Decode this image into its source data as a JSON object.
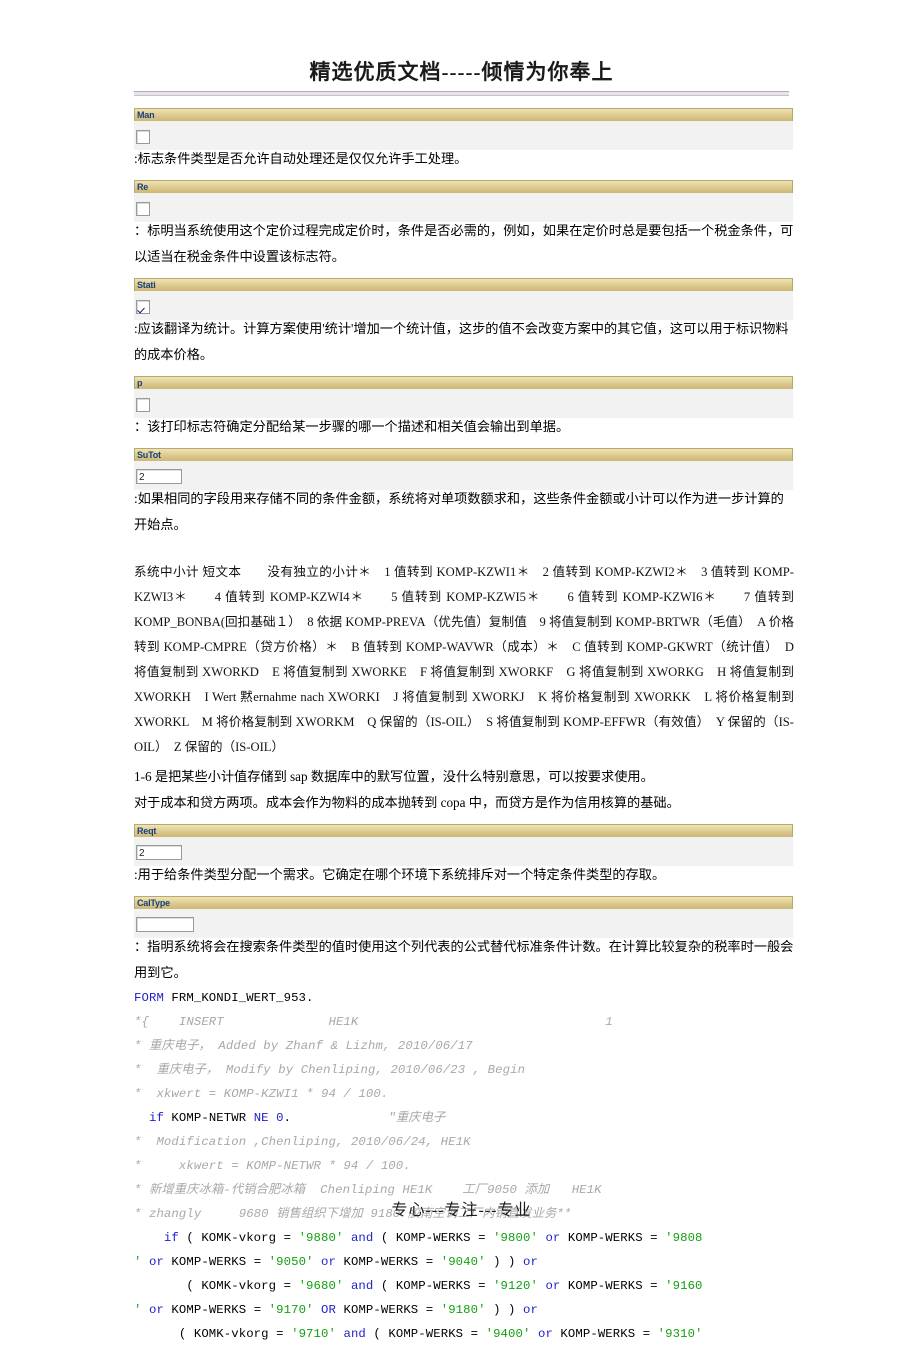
{
  "header": {
    "title": "精选优质文档-----倾情为你奉上"
  },
  "footer": {
    "text": "专心---专注---专业"
  },
  "fields": {
    "man": {
      "caption": "Man",
      "control": "checkbox",
      "checked": false
    },
    "re": {
      "caption": "Re",
      "control": "checkbox",
      "checked": false
    },
    "stat": {
      "caption": "Stati",
      "control": "checkbox",
      "checked": true
    },
    "print": {
      "caption": "p",
      "control": "checkbox",
      "checked": false
    },
    "sutot": {
      "caption": "SuTot",
      "control": "input",
      "value": "2"
    },
    "reqt": {
      "caption": "Reqt",
      "control": "input",
      "value": "2"
    },
    "caltype": {
      "caption": "CalType",
      "control": "input",
      "value": ""
    }
  },
  "paragraphs": {
    "man": ":标志条件类型是否允许自动处理还是仅仅允许手工处理。",
    "re": "：标明当系统使用这个定价过程完成定价时，条件是否必需的，例如，如果在定价时总是要包括一个税金条件，可以适当在税金条件中设置该标志符。",
    "stat": ":应该翻译为统计。计算方案使用'统计'增加一个统计值，这步的值不会改变方案中的其它值，这可以用于标识物料的成本价格。",
    "print": "：该打印标志符确定分配给某一步骤的哪一个描述和相关值会输出到单据。",
    "sutot": ":如果相同的字段用来存储不同的条件金额，系统将对单项数额求和，这些条件金额或小计可以作为进一步计算的开始点。",
    "subtotal_list": "系统中小计 短文本　　没有独立的小计＊　1 值转到 KOMP-KZWI1＊　2 值转到 KOMP-KZWI2＊　3 值转到 KOMP-KZWI3＊　　4 值转到 KOMP-KZWI4＊　　5 值转到 KOMP-KZWI5＊　　6 值转到 KOMP-KZWI6＊　　7 值转到 KOMP_BONBA(回扣基础１）　8 依据 KOMP-PREVA（优先值）复制值　9 将值复制到 KOMP-BRTWR（毛值）　A 价格转到 KOMP-CMPRE（贷方价格）＊　B 值转到 KOMP-WAVWR（成本）＊　C 值转到 KOMP-GKWRT（统计值）　D 将值复制到 XWORKD　E 将值复制到 XWORKE　F 将值复制到 XWORKF　G 将值复制到 XWORKG　H 将值复制到 XWORKH　I Wert 黙ernahme nach XWORKI　J 将值复制到 XWORKJ　K 将价格复制到 XWORKK　L 将价格复制到 XWORKL　M 将价格复制到 XWORKM　Q 保留的（IS-OIL）　S 将值复制到 KOMP-EFFWR（有效值）　Y 保留的（IS-OIL）　Z 保留的（IS-OIL）",
    "note1": "1-6 是把某些小计值存储到 sap 数据库中的默写位置，没什么特别意思，可以按要求使用。",
    "note2": "对于成本和贷方两项。成本会作为物料的成本抛转到 copa 中，而贷方是作为信用核算的基础。",
    "reqt": ":用于给条件类型分配一个需求。它确定在哪个环境下系统排斥对一个特定条件类型的存取。",
    "caltype": "：指明系统将会在搜索条件类型的值时使用这个列代表的公式替代标准条件计数。在计算比较复杂的税率时一般会用到它。"
  },
  "code": {
    "lines": [
      [
        {
          "t": "FORM",
          "c": "kw"
        },
        {
          "t": " FRM_KONDI_WERT_953.",
          "c": "plain"
        }
      ],
      [
        {
          "t": "*{    INSERT              HE1K                                 1",
          "c": "cmt"
        }
      ],
      [
        {
          "t": "* 重庆电子， Added by Zhanf & Lizhm, 2010/06/17",
          "c": "cmt"
        }
      ],
      [
        {
          "t": "*  重庆电子， Modify by Chenliping, 2010/06/23 , Begin",
          "c": "cmt"
        }
      ],
      [
        {
          "t": "*  xkwert = KOMP-KZWI1 * 94 / 100.",
          "c": "cmt"
        }
      ],
      [
        {
          "t": "  ",
          "c": "plain"
        },
        {
          "t": "if",
          "c": "kw"
        },
        {
          "t": " KOMP-NETWR ",
          "c": "plain"
        },
        {
          "t": "NE",
          "c": "kw"
        },
        {
          "t": " ",
          "c": "plain"
        },
        {
          "t": "0",
          "c": "num"
        },
        {
          "t": ".             ",
          "c": "plain"
        },
        {
          "t": "\"重庆电子",
          "c": "cmt"
        }
      ],
      [
        {
          "t": "*  Modification ,Chenliping, 2010/06/24, HE1K",
          "c": "cmt"
        }
      ],
      [
        {
          "t": "*     xkwert = KOMP-NETWR * 94 / 100.",
          "c": "cmt"
        }
      ],
      [
        {
          "t": "* 新增重庆冰箱-代销合肥冰箱  Chenliping HE1K    工厂9050 添加   HE1K",
          "c": "cmt"
        }
      ],
      [
        {
          "t": "* zhangly     9680 销售组织下增加 9180 胶南空调工厂内销直发业务**",
          "c": "cmt"
        }
      ],
      [
        {
          "t": "    ",
          "c": "plain"
        },
        {
          "t": "if",
          "c": "kw"
        },
        {
          "t": " ( KOMK-vkorg = ",
          "c": "plain"
        },
        {
          "t": "'9880'",
          "c": "str"
        },
        {
          "t": " ",
          "c": "plain"
        },
        {
          "t": "and",
          "c": "kw"
        },
        {
          "t": " ( KOMP-WERKS = ",
          "c": "plain"
        },
        {
          "t": "'9800'",
          "c": "str"
        },
        {
          "t": " ",
          "c": "plain"
        },
        {
          "t": "or",
          "c": "kw"
        },
        {
          "t": " KOMP-WERKS = ",
          "c": "plain"
        },
        {
          "t": "'9808",
          "c": "str"
        }
      ],
      [
        {
          "t": "'",
          "c": "str"
        },
        {
          "t": " ",
          "c": "plain"
        },
        {
          "t": "or",
          "c": "kw"
        },
        {
          "t": " KOMP-WERKS = ",
          "c": "plain"
        },
        {
          "t": "'9050'",
          "c": "str"
        },
        {
          "t": " ",
          "c": "plain"
        },
        {
          "t": "or",
          "c": "kw"
        },
        {
          "t": " KOMP-WERKS = ",
          "c": "plain"
        },
        {
          "t": "'9040'",
          "c": "str"
        },
        {
          "t": " ) ) ",
          "c": "plain"
        },
        {
          "t": "or",
          "c": "kw"
        }
      ],
      [
        {
          "t": "       ( KOMK-vkorg = ",
          "c": "plain"
        },
        {
          "t": "'9680'",
          "c": "str"
        },
        {
          "t": " ",
          "c": "plain"
        },
        {
          "t": "and",
          "c": "kw"
        },
        {
          "t": " ( KOMP-WERKS = ",
          "c": "plain"
        },
        {
          "t": "'9120'",
          "c": "str"
        },
        {
          "t": " ",
          "c": "plain"
        },
        {
          "t": "or",
          "c": "kw"
        },
        {
          "t": " KOMP-WERKS = ",
          "c": "plain"
        },
        {
          "t": "'9160",
          "c": "str"
        }
      ],
      [
        {
          "t": "'",
          "c": "str"
        },
        {
          "t": " ",
          "c": "plain"
        },
        {
          "t": "or",
          "c": "kw"
        },
        {
          "t": " KOMP-WERKS = ",
          "c": "plain"
        },
        {
          "t": "'9170'",
          "c": "str"
        },
        {
          "t": " ",
          "c": "plain"
        },
        {
          "t": "OR",
          "c": "kw"
        },
        {
          "t": " KOMP-WERKS = ",
          "c": "plain"
        },
        {
          "t": "'9180'",
          "c": "str"
        },
        {
          "t": " ) ) ",
          "c": "plain"
        },
        {
          "t": "or",
          "c": "kw"
        }
      ],
      [
        {
          "t": "      ( KOMK-vkorg = ",
          "c": "plain"
        },
        {
          "t": "'9710'",
          "c": "str"
        },
        {
          "t": " ",
          "c": "plain"
        },
        {
          "t": "and",
          "c": "kw"
        },
        {
          "t": " ( KOMP-WERKS = ",
          "c": "plain"
        },
        {
          "t": "'9400'",
          "c": "str"
        },
        {
          "t": " ",
          "c": "plain"
        },
        {
          "t": "or",
          "c": "kw"
        },
        {
          "t": " KOMP-WERKS = ",
          "c": "plain"
        },
        {
          "t": "'9310'",
          "c": "str"
        }
      ]
    ]
  }
}
